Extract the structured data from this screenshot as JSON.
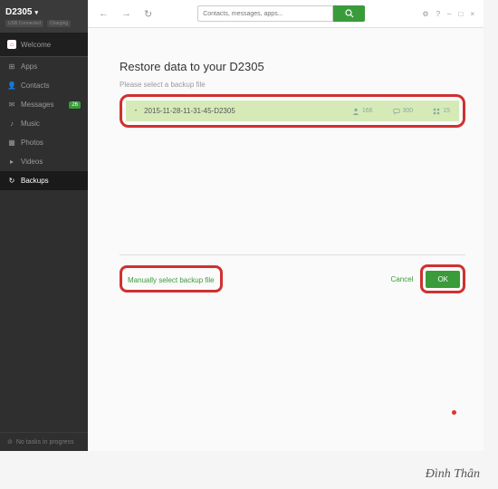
{
  "device": {
    "name": "D2305",
    "status1": "USB Connected",
    "status2": "Charging"
  },
  "sidebar": {
    "welcome": "Welcome",
    "items": [
      {
        "icon": "⊞",
        "label": "Apps"
      },
      {
        "icon": "👤",
        "label": "Contacts"
      },
      {
        "icon": "✉",
        "label": "Messages",
        "badge": "26"
      },
      {
        "icon": "♪",
        "label": "Music"
      },
      {
        "icon": "▦",
        "label": "Photos"
      },
      {
        "icon": "▸",
        "label": "Videos"
      },
      {
        "icon": "↻",
        "label": "Backups",
        "active": true
      }
    ],
    "footer": "No tasks in progress"
  },
  "toolbar": {
    "search_placeholder": "Contacts, messages, apps..."
  },
  "content": {
    "title": "Restore data to your D2305",
    "subtitle": "Please select a backup file",
    "backup": {
      "filename": "2015-11-28-11-31-45-D2305",
      "contacts": "166",
      "messages": "300",
      "apps": "15"
    },
    "manual_link": "Manually select backup file",
    "cancel": "Cancel",
    "ok": "OK"
  },
  "signature": "Đình Thân"
}
